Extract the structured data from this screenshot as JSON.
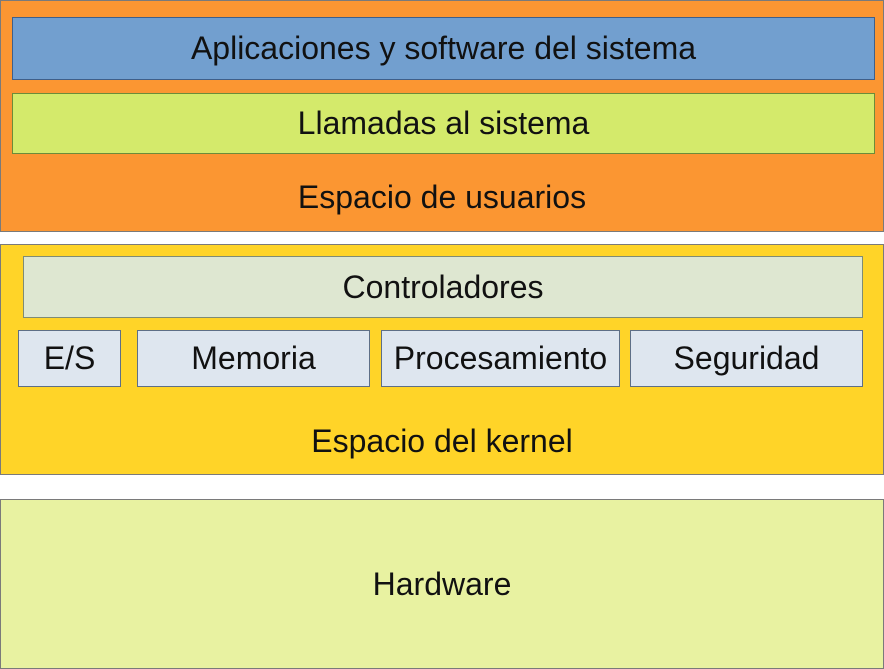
{
  "user_space": {
    "label": "Espacio de usuarios",
    "applications": "Aplicaciones y software del sistema",
    "system_calls": "Llamadas al sistema"
  },
  "kernel_space": {
    "label": "Espacio del kernel",
    "drivers": "Controladores",
    "modules": [
      "E/S",
      "Memoria",
      "Procesamiento",
      "Seguridad"
    ]
  },
  "hardware": {
    "label": "Hardware"
  },
  "colors": {
    "user_space": "#fb9632",
    "applications": "#729fcf",
    "system_calls": "#d4ea6b",
    "kernel_space": "#ffd428",
    "drivers": "#dee7d1",
    "modules": "#dee6ef",
    "hardware": "#e8f2a1"
  }
}
